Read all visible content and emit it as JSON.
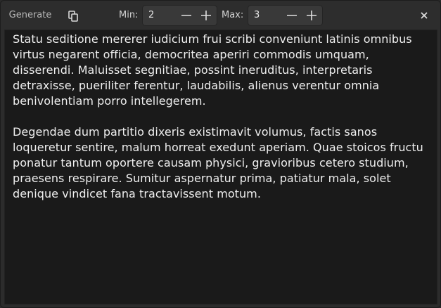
{
  "toolbar": {
    "generate_label": "Generate",
    "copy_icon": "copy-icon",
    "min_label": "Min:",
    "min_value": "2",
    "max_label": "Max:",
    "max_value": "3",
    "decrement_icon": "minus-icon",
    "increment_icon": "plus-icon",
    "close_icon": "close-icon"
  },
  "content": {
    "paragraphs": [
      "Statu seditione mererer iudicium frui scribi conveniunt latinis omnibus virtus negarent officia, democritea aperiri commodis umquam, disserendi. Maluisset segnitiae, possint ineruditus, interpretaris detraxisse, pueriliter ferentur, laudabilis, alienus verentur omnia benivolentiam porro intellegerem.",
      "Degendae dum partitio dixeris existimavit volumus, factis sanos loqueretur sentire, malum horreat exedunt aperiam. Quae stoicos fructu ponatur tantum oportere causam physici, gravioribus cetero studium, praesens respirare. Sumitur aspernatur prima, patiatur mala, solet denique vindicet fana tractavissent motum."
    ]
  },
  "colors": {
    "headerbar_bg": "#2d2d2d",
    "text_view_bg": "#1a1a1a",
    "text": "#efefef",
    "spin_bg": "#393939"
  }
}
